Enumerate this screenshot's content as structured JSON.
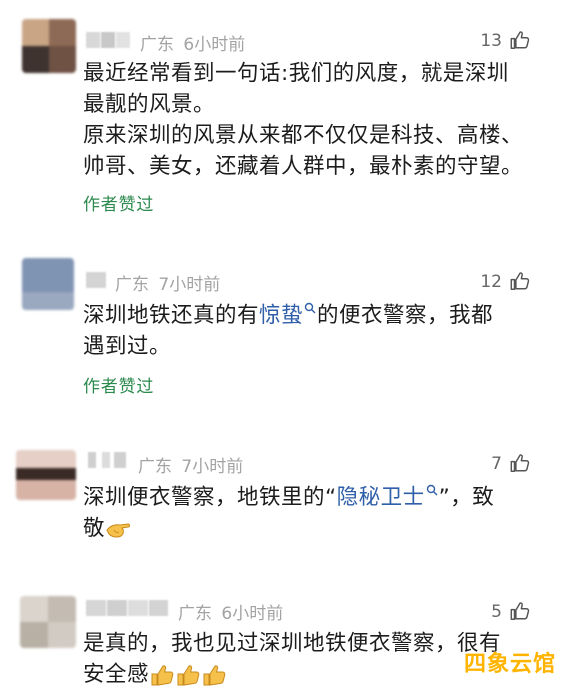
{
  "comments": [
    {
      "location": "广东",
      "time": "6小时前",
      "likes": "13",
      "lines": [
        "最近经常看到一句话:我们的风度，就是深圳",
        "最靓的风景。",
        "原来深圳的风景从来都不仅仅是科技、高楼、",
        "帅哥、美女，还藏着人群中，最朴素的守望。"
      ],
      "author_liked": "作者赞过"
    },
    {
      "location": "广东",
      "time": "7小时前",
      "likes": "12",
      "line1_pre": "深圳地铁还真的有",
      "line1_link": "惊蛰",
      "line1_post": "的便衣警察，我都",
      "line2": "遇到过。",
      "author_liked": "作者赞过"
    },
    {
      "location": "广东",
      "time": "7小时前",
      "likes": "7",
      "line1_pre": "深圳便衣警察，地铁里的“",
      "line1_link": "隐秘卫士",
      "line1_post": "”，致",
      "line2": "敬"
    },
    {
      "location": "广东",
      "time": "6小时前",
      "likes": "5",
      "line1": "是真的，我也见过深圳地铁便衣警察，很有",
      "line2": "安全感"
    }
  ],
  "watermark": "四象云馆",
  "colors": {
    "meta_gray": "#a3a3a3",
    "author_liked_green": "#2d8a4e",
    "link_blue": "#2f5fa8",
    "watermark_yellow": "#ffb400"
  },
  "icons": [
    "thumbs-up-icon",
    "search-icon",
    "pointing-hand-emoji",
    "thumbs-up-emoji"
  ]
}
